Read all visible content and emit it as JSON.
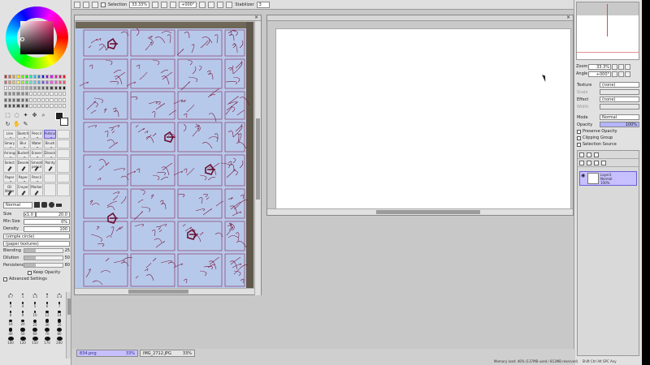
{
  "toolbar": {
    "selection_label": "Selection",
    "zoom": "33.33%",
    "rotation": "+000°",
    "stabilizer_label": "Stabilizer",
    "stabilizer_value": "3"
  },
  "brush_tools": [
    [
      "Line",
      "Sketch",
      "Pencil",
      "Airbrush",
      ""
    ],
    [
      "Smary",
      "Blur",
      "Water",
      "Brush",
      ""
    ],
    [
      "Arrange",
      "Bucket",
      "Eraser",
      "Dissolve",
      ""
    ],
    [
      "Select",
      "Deselect",
      "Smooth pencil",
      "Pointy",
      ""
    ],
    [
      "Paper",
      "Paper",
      "Pencil",
      "",
      ""
    ],
    [
      "Oil Water",
      "Crayon",
      "Marker",
      "",
      ""
    ]
  ],
  "brush_settings": {
    "mode": "Normal",
    "size_label": "Size",
    "size_multiplier": "x1.0",
    "size_value": "20.0",
    "min_size_label": "Min Size",
    "min_size_value": "0%",
    "density_label": "Density",
    "density_value": "100",
    "shape": "(simple circle)",
    "texture": "(paper textures)",
    "blending_label": "Blending",
    "blending_value": "25",
    "dilution_label": "Dilution",
    "dilution_value": "50",
    "persistence_label": "Persistence",
    "persistence_value": "80",
    "keep_opacity": "Keep Opacity",
    "advanced": "Advanced Settings"
  },
  "brush_sizes": [
    "0.7",
    "1",
    "1.5",
    "2",
    "2.3",
    "3",
    "4",
    "5",
    "6",
    "7",
    "8",
    "9",
    "10",
    "12",
    "14",
    "16",
    "20",
    "25",
    "30",
    "35",
    "40",
    "50",
    "60",
    "70",
    "80",
    "100",
    "120",
    "150",
    "170",
    "200"
  ],
  "navigator": {
    "zoom_label": "Zoom",
    "zoom_value": "33.3%",
    "angle_label": "Angle",
    "angle_value": "+000°"
  },
  "layer_panel": {
    "texture_label": "Texture",
    "texture_value": "(none)",
    "scale_label": "Scale",
    "effect_label": "Effect",
    "effect_value": "(none)",
    "width_label": "Width",
    "mode_label": "Mode",
    "mode_value": "Normal",
    "opacity_label": "Opacity",
    "opacity_value": "100%",
    "preserve_opacity": "Preserve Opacity",
    "clipping_group": "Clipping Group",
    "selection_source": "Selection Source"
  },
  "layers": [
    {
      "name": "Layer1",
      "mode": "Normal",
      "opacity": "100%"
    }
  ],
  "documents": [
    {
      "name": "834.png",
      "zoom": "33%",
      "active": true
    },
    {
      "name": "IMG_2712.JPG",
      "zoom": "33%",
      "active": false
    }
  ],
  "status": {
    "memory": "Memory load: 46% (137MB used / 813MB reserved)",
    "keys": "Shift Ctrl Alt SPC Any"
  },
  "colors": {
    "accent": "#c7c0ff",
    "sketch_ink": "#8a1a3a",
    "photo_paper": "#b7c9ea"
  }
}
